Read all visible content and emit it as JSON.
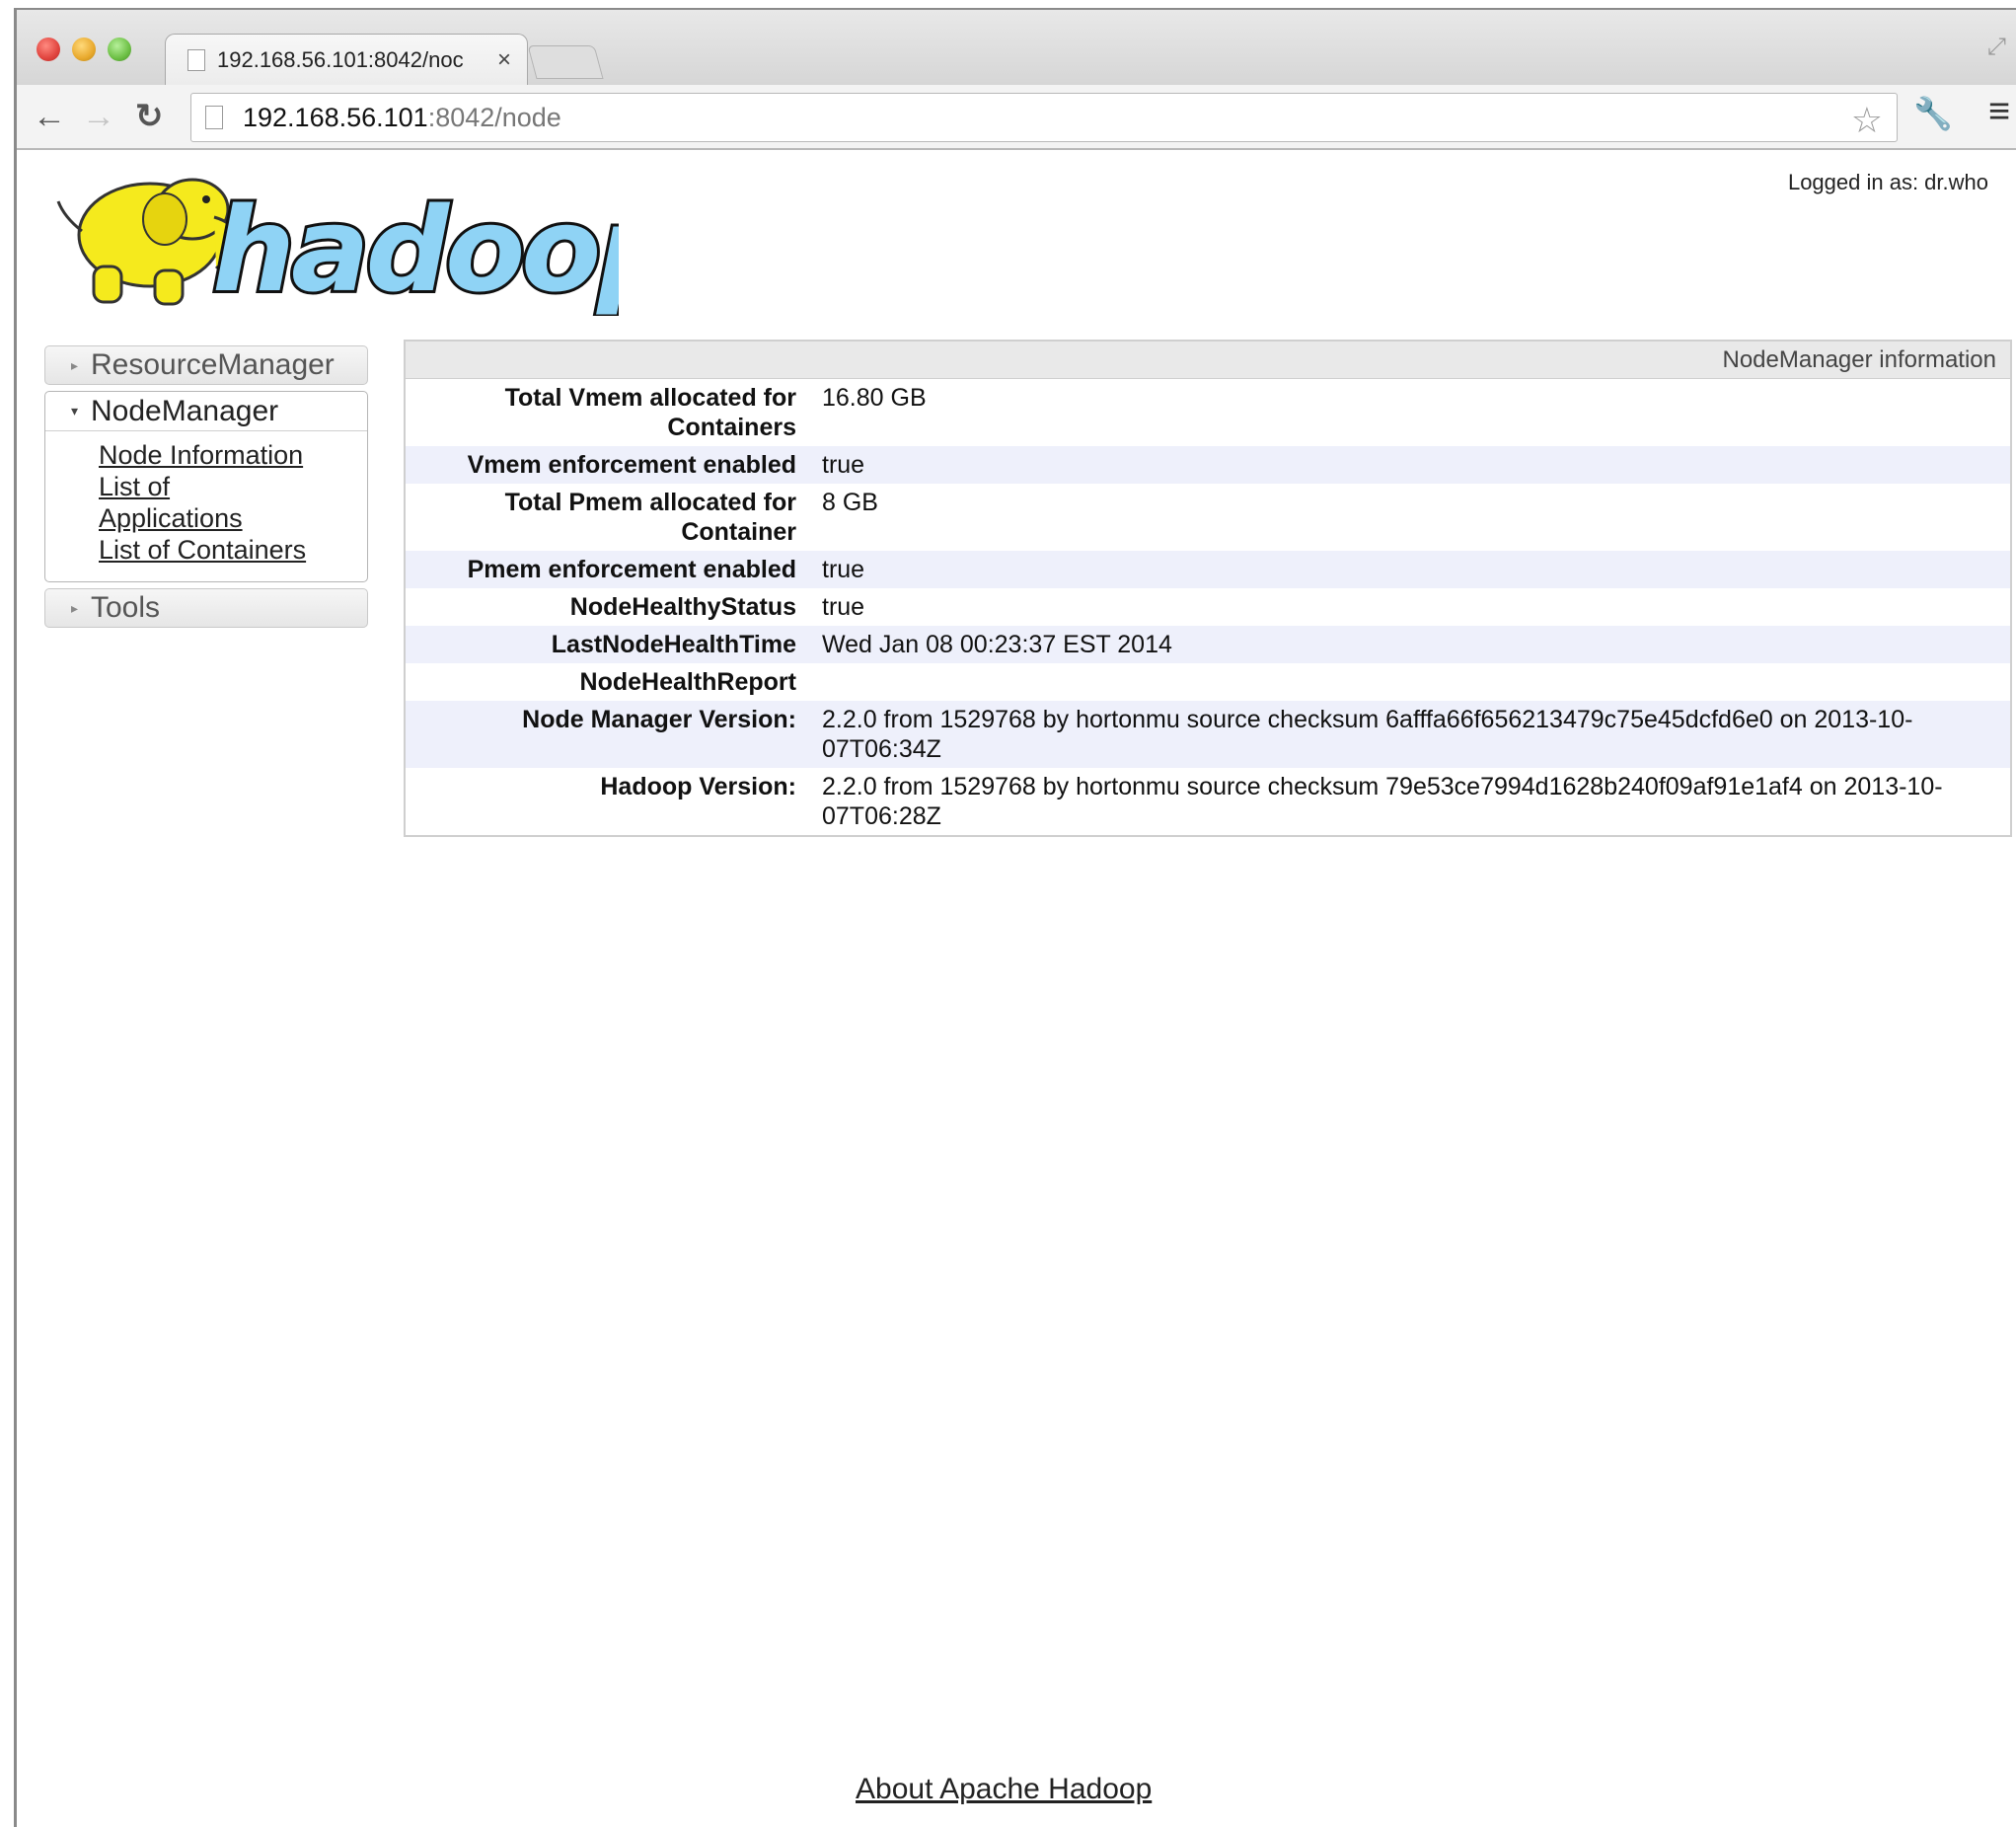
{
  "browser": {
    "tab_title": "192.168.56.101:8042/noc",
    "tab_close": "×",
    "url_host": "192.168.56.101",
    "url_rest": ":8042/node"
  },
  "header": {
    "logged_in": "Logged in as: dr.who",
    "logo_text": "hadoop"
  },
  "sidebar": {
    "sections": [
      {
        "label": "ResourceManager",
        "expanded": false
      },
      {
        "label": "NodeManager",
        "expanded": true
      },
      {
        "label": "Tools",
        "expanded": false
      }
    ],
    "links": [
      "Node Information",
      "List of Applications",
      "List of Containers"
    ]
  },
  "info": {
    "title": "NodeManager information",
    "rows": [
      {
        "key": "Total Vmem allocated for Containers",
        "value": "16.80 GB"
      },
      {
        "key": "Vmem enforcement enabled",
        "value": "true"
      },
      {
        "key": "Total Pmem allocated for Container",
        "value": "8 GB"
      },
      {
        "key": "Pmem enforcement enabled",
        "value": "true"
      },
      {
        "key": "NodeHealthyStatus",
        "value": "true"
      },
      {
        "key": "LastNodeHealthTime",
        "value": "Wed Jan 08 00:23:37 EST 2014"
      },
      {
        "key": "NodeHealthReport",
        "value": ""
      },
      {
        "key": "Node Manager Version:",
        "value": "2.2.0 from 1529768 by hortonmu source checksum 6afffa66f656213479c75e45dcfd6e0 on 2013-10-07T06:34Z"
      },
      {
        "key": "Hadoop Version:",
        "value": "2.2.0 from 1529768 by hortonmu source checksum 79e53ce7994d1628b240f09af91e1af4 on 2013-10-07T06:28Z"
      }
    ]
  },
  "footer": {
    "about_link": "About Apache Hadoop"
  },
  "colors": {
    "logo_blue": "#8fd3f5",
    "elephant_yellow": "#f5ea1d",
    "row_alt": "#eef0fb"
  }
}
